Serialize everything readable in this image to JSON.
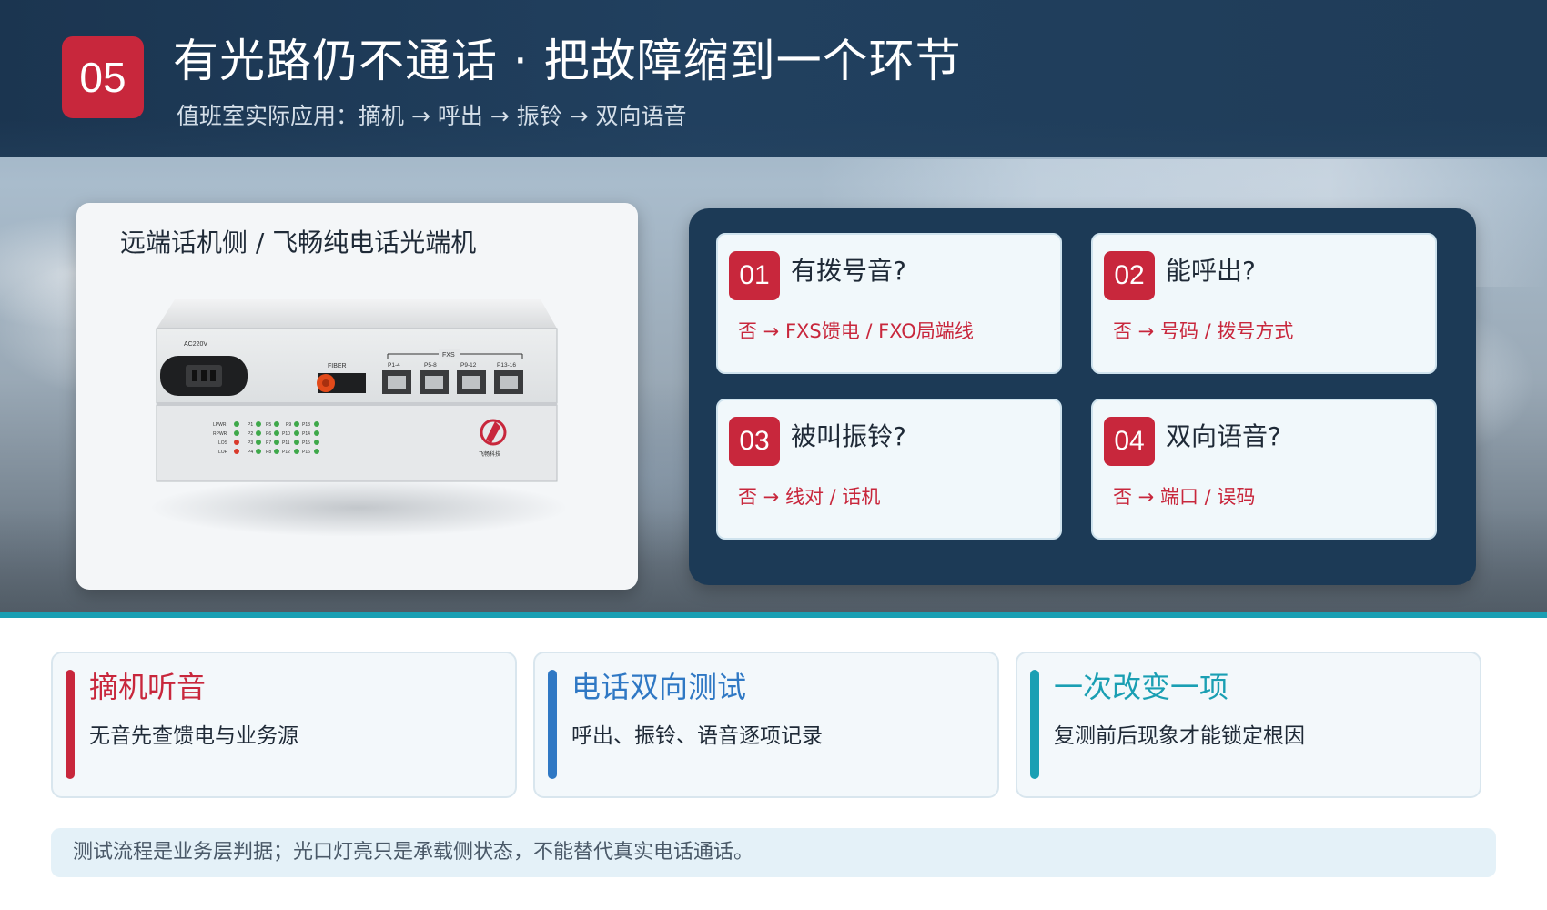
{
  "header": {
    "number": "05",
    "title": "有光路仍不通话 · 把故障缩到一个环节",
    "subtitle": "值班室实际应用：摘机 → 呼出 → 振铃 → 双向语音"
  },
  "device": {
    "caption": "远端话机侧 / 飞畅纯电话光端机",
    "panel_labels": {
      "power": "AC220V",
      "fiber": "FIBER",
      "fxs": "FXS",
      "ports": [
        "P1-4",
        "P5-8",
        "P9-12",
        "P13-16"
      ]
    },
    "led_labels": {
      "status": [
        "LPWR",
        "RPWR",
        "LOS",
        "LOF"
      ],
      "col1": [
        "P1",
        "P2",
        "P3",
        "P4"
      ],
      "col2": [
        "P5",
        "P6",
        "P7",
        "P8"
      ],
      "col3": [
        "P9",
        "P10",
        "P11",
        "P12"
      ],
      "col4": [
        "P13",
        "P14",
        "P15",
        "P16"
      ]
    },
    "logo_text": "飞畅科技"
  },
  "checks": [
    {
      "num": "01",
      "question": "有拨号音?",
      "answer": "否 → FXS馈电 / FXO局端线"
    },
    {
      "num": "02",
      "question": "能呼出?",
      "answer": "否 → 号码 / 拨号方式"
    },
    {
      "num": "03",
      "question": "被叫振铃?",
      "answer": "否 → 线对 / 话机"
    },
    {
      "num": "04",
      "question": "双向语音?",
      "answer": "否 → 端口 / 误码"
    }
  ],
  "tips": [
    {
      "title": "摘机听音",
      "body": "无音先查馈电与业务源",
      "color": "#c8273c"
    },
    {
      "title": "电话双向测试",
      "body": "呼出、振铃、语音逐项记录",
      "color": "#2f78c4"
    },
    {
      "title": "一次改变一项",
      "body": "复测前后现象才能锁定根因",
      "color": "#1a9fb3"
    }
  ],
  "footer": {
    "note": "测试流程是业务层判据；光口灯亮只是承载侧状态，不能替代真实电话通话。"
  },
  "colors": {
    "accent_red": "#c8273c",
    "navy": "#1c3a56",
    "teal": "#1a9fb3",
    "blue": "#2f78c4"
  }
}
